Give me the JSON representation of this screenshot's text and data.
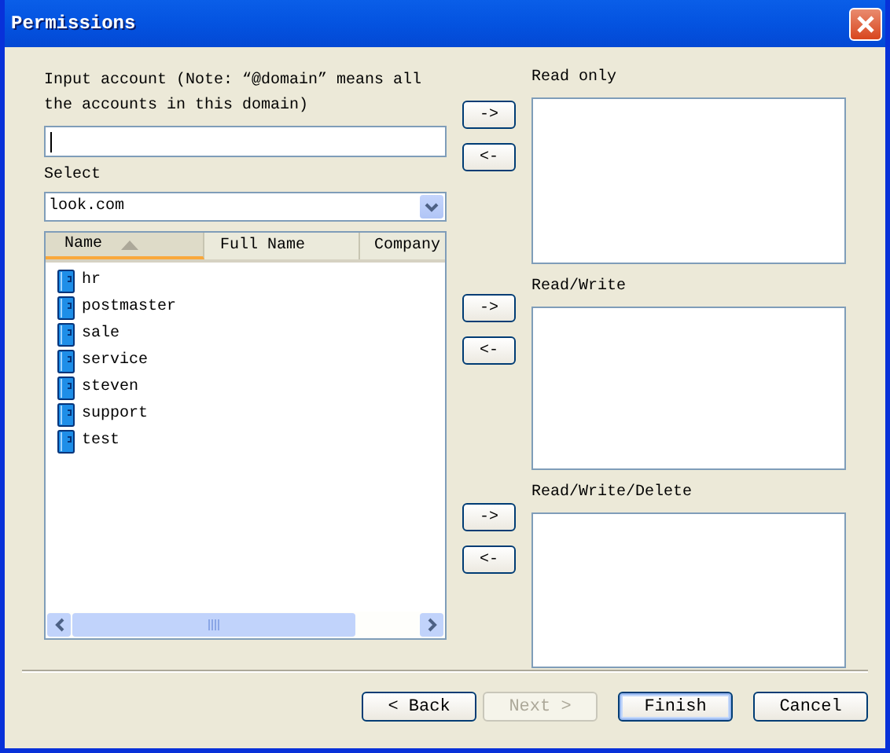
{
  "window": {
    "title": "Permissions"
  },
  "account": {
    "label": "Input account (Note: “@domain” means all the accounts in this domain)",
    "focused": true
  },
  "domain_select": {
    "label": "Select",
    "value": "look.com"
  },
  "accounts": {
    "columns": [
      {
        "label": "Name",
        "sorted": true
      },
      {
        "label": "Full Name",
        "sorted": false
      },
      {
        "label": "Company",
        "sorted": false
      }
    ],
    "rows": [
      {
        "name": "hr"
      },
      {
        "name": "postmaster"
      },
      {
        "name": "sale"
      },
      {
        "name": "service"
      },
      {
        "name": "steven"
      },
      {
        "name": "support"
      },
      {
        "name": "test"
      }
    ]
  },
  "permission_lists": [
    {
      "label": "Read only",
      "add": "->",
      "remove": "<-"
    },
    {
      "label": "Read/Write",
      "add": "->",
      "remove": "<-"
    },
    {
      "label": "Read/Write/Delete",
      "add": "->",
      "remove": "<-"
    }
  ],
  "buttons": [
    {
      "label": "< Back",
      "disabled": false,
      "default": false
    },
    {
      "label": "Next >",
      "disabled": true,
      "default": false
    },
    {
      "label": "Finish",
      "disabled": false,
      "default": true
    },
    {
      "label": "Cancel",
      "disabled": false,
      "default": false
    }
  ]
}
